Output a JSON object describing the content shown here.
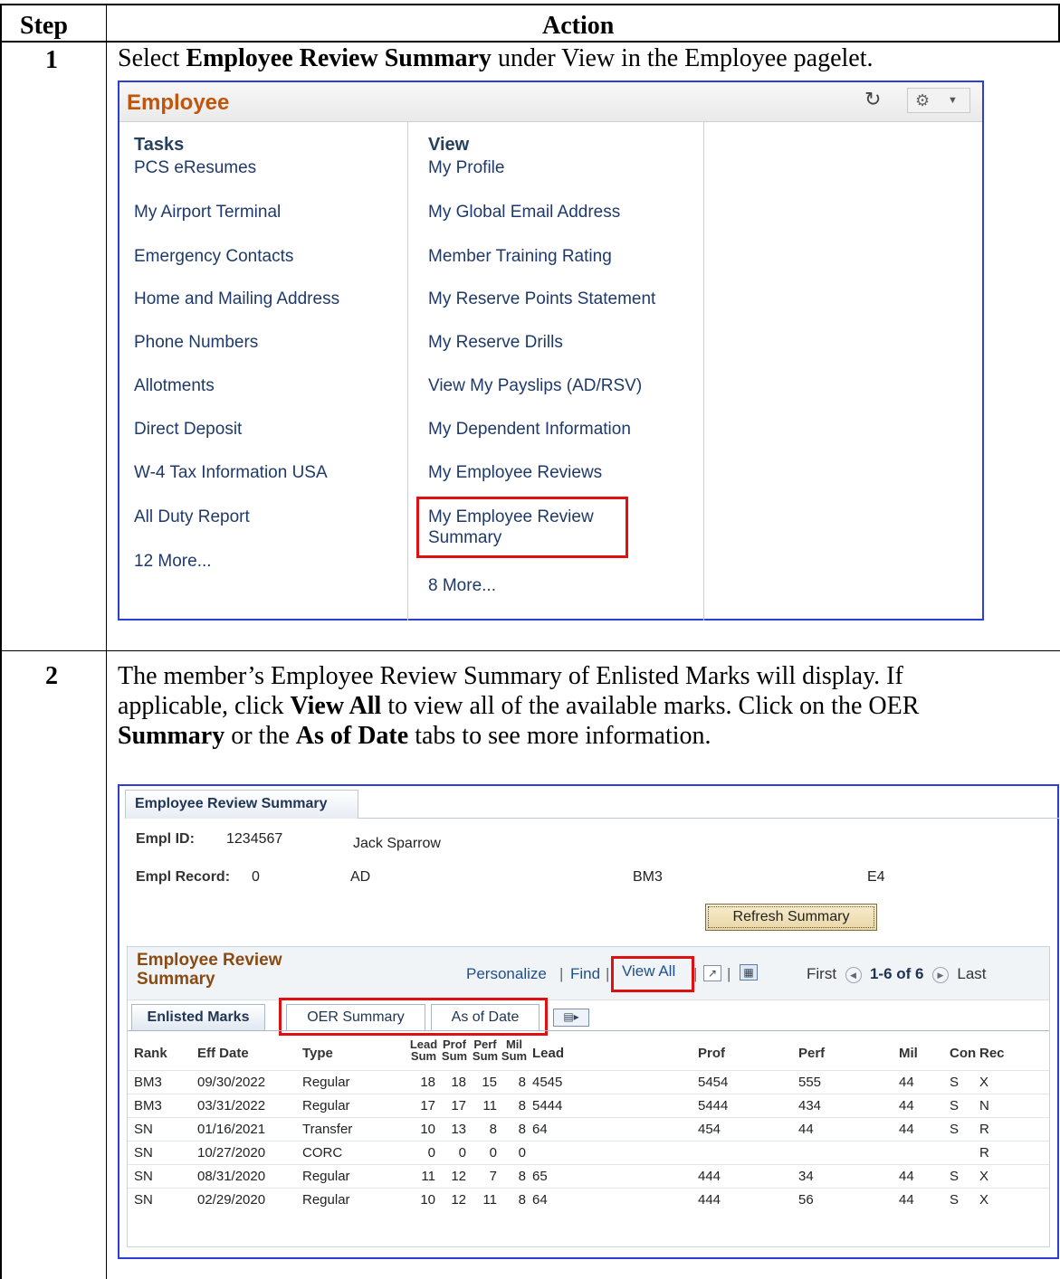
{
  "doc": {
    "header_step": "Step",
    "header_action": "Action",
    "step1_num": "1",
    "step1_text": {
      "pre": "Select ",
      "bold": "Employee Review Summary",
      "post": " under View in the Employee pagelet."
    },
    "step2_num": "2",
    "step2_text": {
      "l1": "The member’s Employee Review Summary of Enlisted Marks will display. If",
      "l2_pre": "applicable, click ",
      "l2_bold": "View All",
      "l2_post": " to view all of the available marks. Click on the OER",
      "l3_bold1": "Summary",
      "l3_mid": " or the ",
      "l3_bold2": "As of Date",
      "l3_post": " tabs to see more information."
    }
  },
  "pagelet": {
    "title": "Employee",
    "tasks_heading": "Tasks",
    "view_heading": "View",
    "tasks": [
      "PCS eResumes",
      "My Airport Terminal",
      "Emergency Contacts",
      "Home and Mailing Address",
      "Phone Numbers",
      "Allotments",
      "Direct Deposit",
      "W-4 Tax Information USA",
      "All Duty Report",
      "12 More..."
    ],
    "view": [
      "My Profile",
      "My Global Email Address",
      "Member Training Rating",
      "My Reserve Points Statement",
      "My Reserve Drills",
      "View My Payslips (AD/RSV)",
      "My Dependent Information",
      "My Employee Reviews",
      "My Employee Review",
      "Summary",
      "8 More..."
    ]
  },
  "summary": {
    "tab": "Employee Review Summary",
    "empl_id_label": "Empl ID:",
    "empl_id": "1234567",
    "name": "Jack Sparrow",
    "empl_record_label": "Empl Record:",
    "empl_record": "0",
    "component": "AD",
    "rate": "BM3",
    "grade": "E4",
    "refresh_button": "Refresh Summary",
    "grid_title_l1": "Employee Review",
    "grid_title_l2": "Summary",
    "personalize": "Personalize",
    "find": "Find",
    "view_all": "View All",
    "first": "First",
    "range": "1-6 of 6",
    "last": "Last",
    "tabs": [
      "Enlisted Marks",
      "OER Summary",
      "As of Date"
    ],
    "columns": [
      "Rank",
      "Eff Date",
      "Type",
      "Lead Sum",
      "Prof Sum",
      "Perf Sum",
      "Mil Sum",
      "Lead",
      "Prof",
      "Perf",
      "Mil",
      "Con",
      "Rec"
    ],
    "col_split": {
      "lead_sum": [
        "Lead",
        "Sum"
      ],
      "prof_sum": [
        "Prof",
        "Sum"
      ],
      "perf_sum": [
        "Perf",
        "Sum"
      ],
      "mil_sum": [
        "Mil",
        "Sum"
      ]
    },
    "rows": [
      [
        "BM3",
        "09/30/2022",
        "Regular",
        "18",
        "18",
        "15",
        "8",
        "4545",
        "5454",
        "555",
        "44",
        "S",
        "X"
      ],
      [
        "BM3",
        "03/31/2022",
        "Regular",
        "17",
        "17",
        "11",
        "8",
        "5444",
        "5444",
        "434",
        "44",
        "S",
        "N"
      ],
      [
        "SN",
        "01/16/2021",
        "Transfer",
        "10",
        "13",
        "8",
        "8",
        "64",
        "454",
        "44",
        "44",
        "S",
        "R"
      ],
      [
        "SN",
        "10/27/2020",
        "CORC",
        "0",
        "0",
        "0",
        "0",
        "",
        "",
        "",
        "",
        "",
        "R"
      ],
      [
        "SN",
        "08/31/2020",
        "Regular",
        "11",
        "12",
        "7",
        "8",
        "65",
        "444",
        "34",
        "44",
        "S",
        "X"
      ],
      [
        "SN",
        "02/29/2020",
        "Regular",
        "10",
        "12",
        "11",
        "8",
        "64",
        "444",
        "56",
        "44",
        "S",
        "X"
      ]
    ]
  }
}
